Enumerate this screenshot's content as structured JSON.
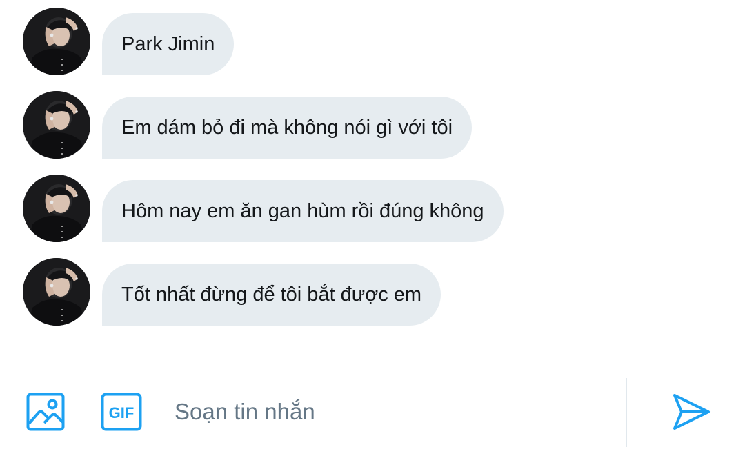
{
  "conversation": {
    "messages": [
      {
        "sender": "Park Jimin",
        "text": "Park Jimin"
      },
      {
        "sender": "Park Jimin",
        "text": "Em dám bỏ đi mà không nói gì với tôi"
      },
      {
        "sender": "Park Jimin",
        "text": "Hôm nay em ăn gan hùm rồi đúng không"
      },
      {
        "sender": "Park Jimin",
        "text": "Tốt nhất đừng để tôi bắt được em"
      }
    ]
  },
  "composer": {
    "placeholder": "Soạn tin nhắn",
    "value": "",
    "gif_label": "GIF"
  },
  "icons": {
    "media": "image-icon",
    "gif": "gif-icon",
    "send": "send-icon"
  },
  "colors": {
    "accent": "#1da1f2",
    "bubble_bg": "#e6ecf0",
    "text": "#14171a",
    "placeholder": "#657786",
    "divider": "#e1e8ed"
  }
}
